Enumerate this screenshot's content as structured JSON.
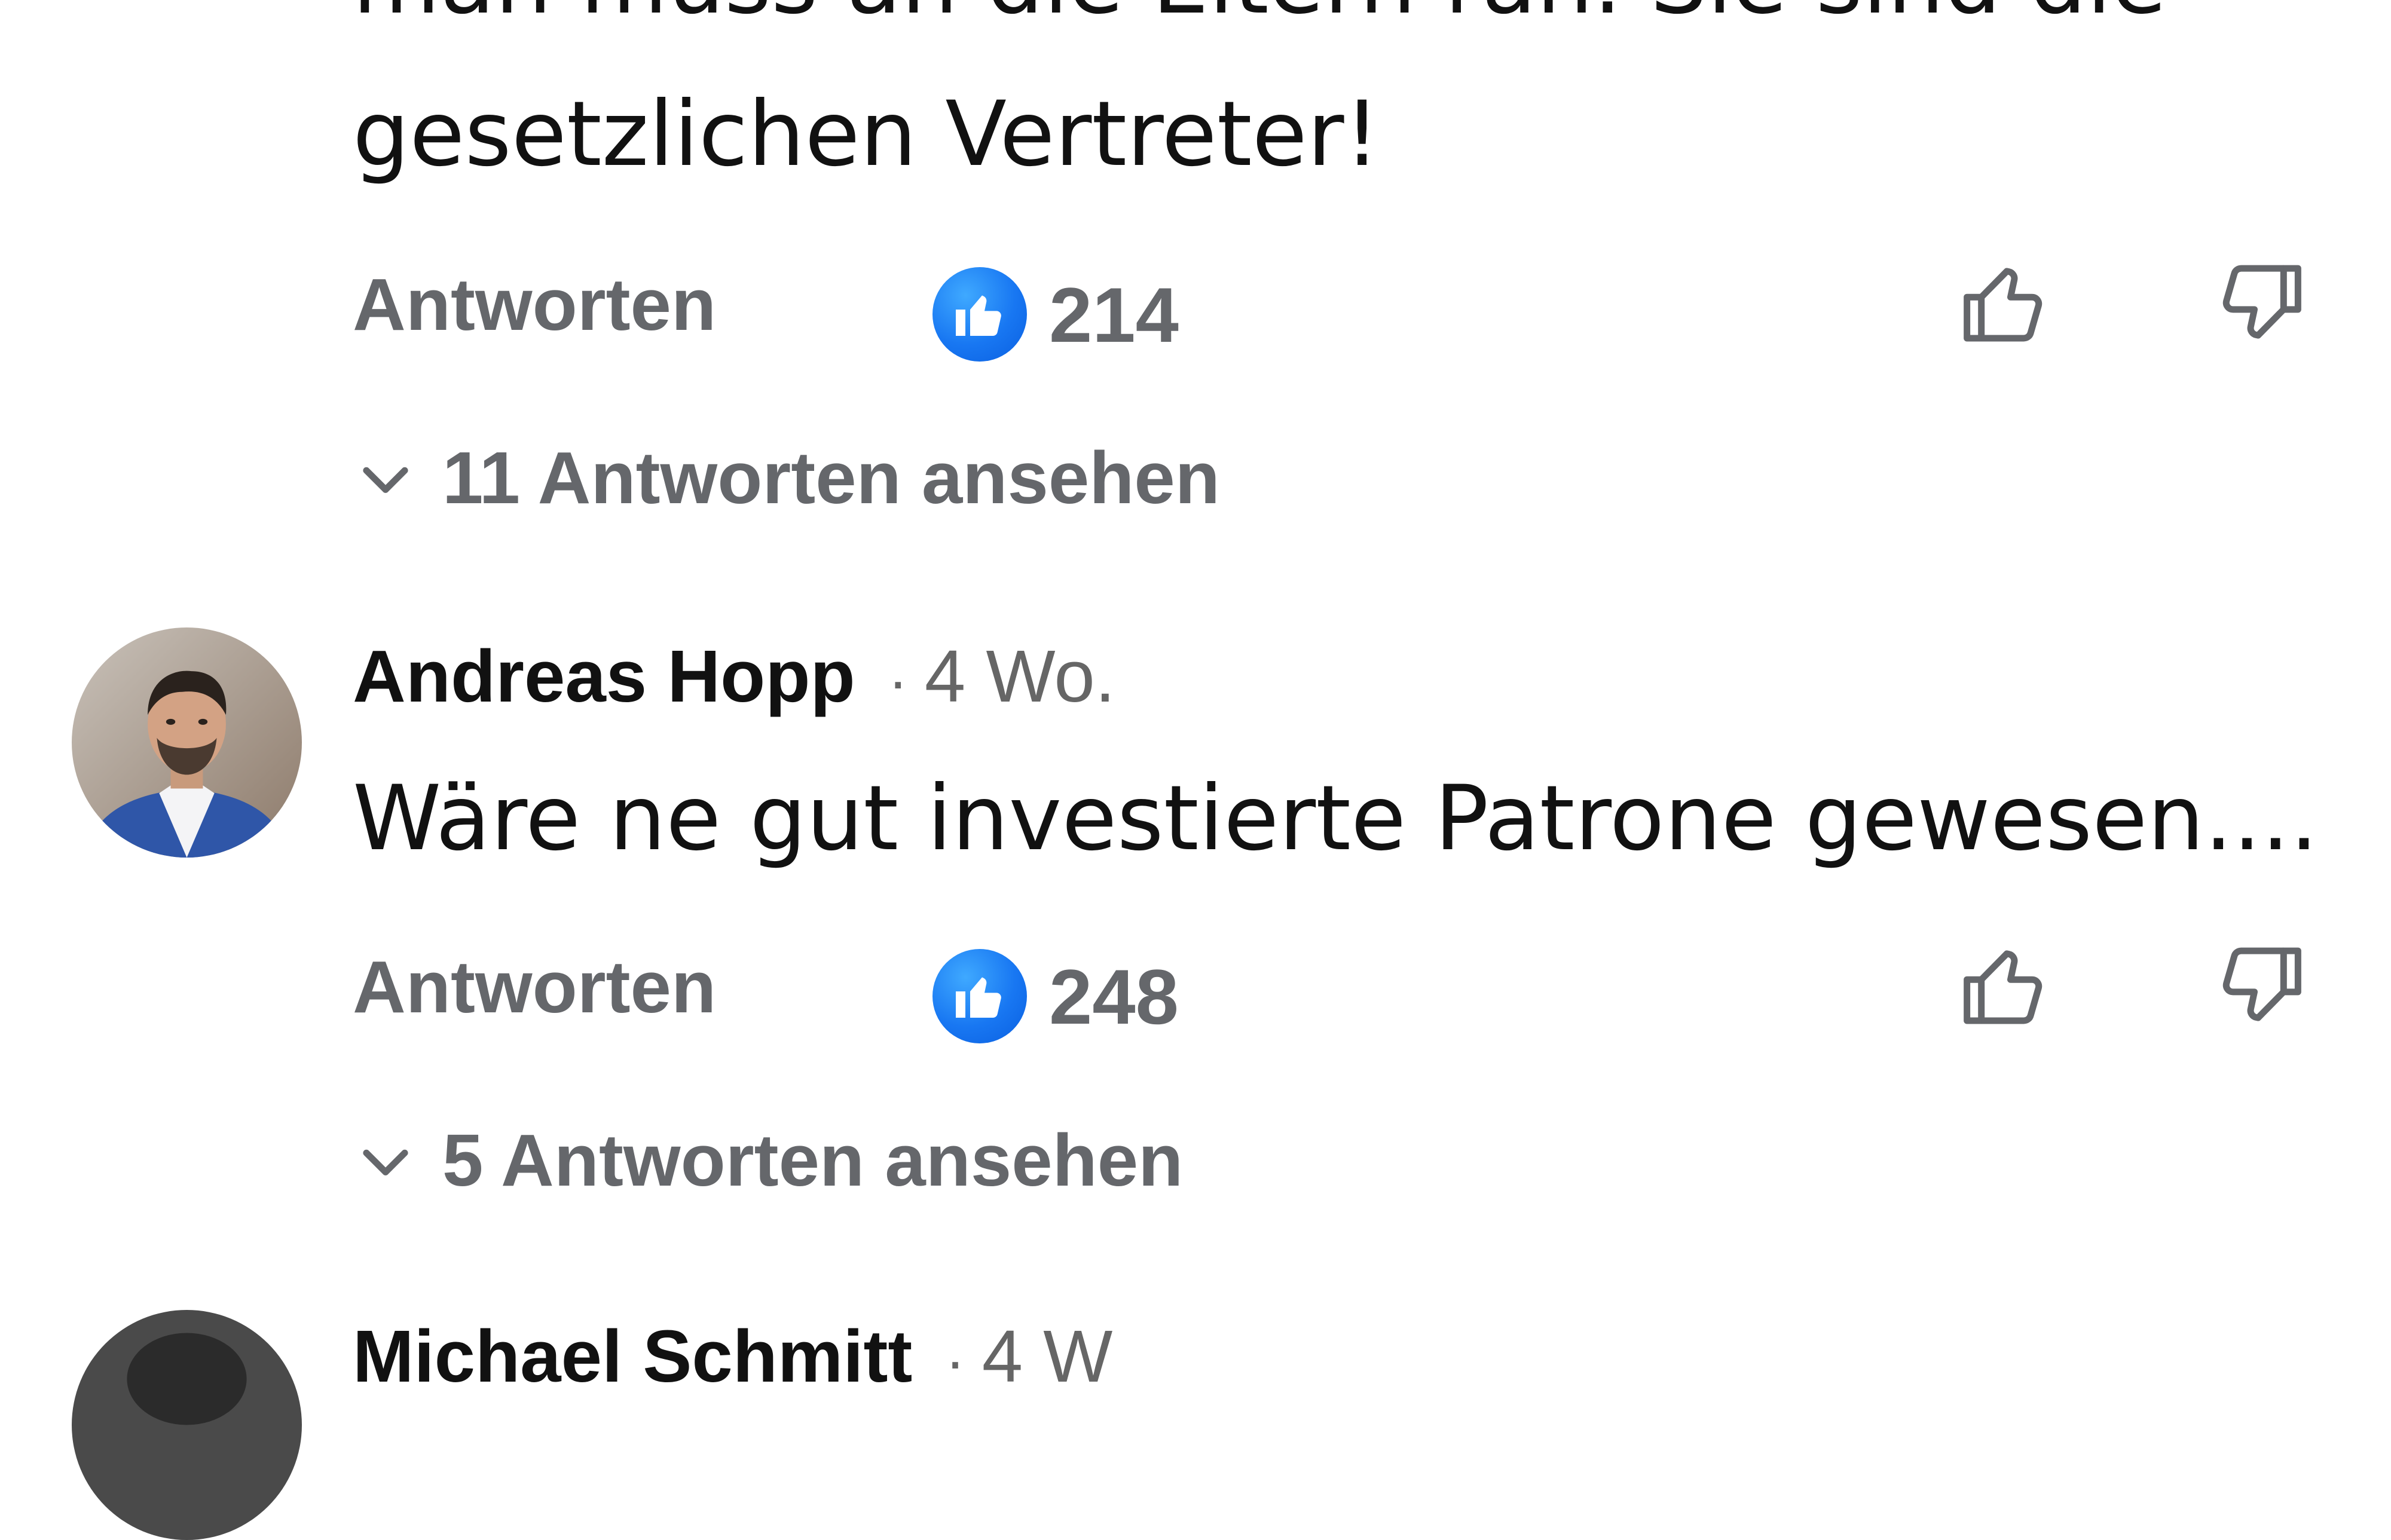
{
  "comments": [
    {
      "body_line1": "man muss an die Eltern ran. Sie sind die",
      "body_line2": "gesetzlichen Vertreter!",
      "reply_label": "Antworten",
      "like_count": "214",
      "view_replies": "11 Antworten ansehen",
      "like_icon": "thumbs-up-icon",
      "dislike_icon": "thumbs-down-icon",
      "reaction_icon": "like-reaction-icon"
    },
    {
      "author": "Andreas Hopp",
      "separator": "·",
      "time": "4 Wo.",
      "body": "Wäre ne gut investierte Patrone gewesen....",
      "reply_label": "Antworten",
      "like_count": "248",
      "view_replies": "5 Antworten ansehen",
      "like_icon": "thumbs-up-icon",
      "dislike_icon": "thumbs-down-icon",
      "reaction_icon": "like-reaction-icon"
    },
    {
      "author": "Michael Schmitt",
      "separator": "·",
      "time": "4 W"
    }
  ],
  "colors": {
    "text_primary": "#111111",
    "text_secondary": "#65676b",
    "like_blue": "#1877f2",
    "background": "#ffffff"
  }
}
